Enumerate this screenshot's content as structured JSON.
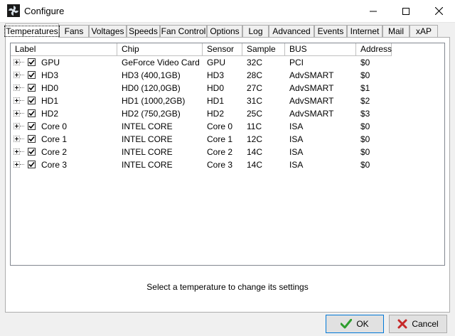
{
  "window": {
    "title": "Configure"
  },
  "tabs": [
    "Temperatures",
    "Fans",
    "Voltages",
    "Speeds",
    "Fan Control",
    "Options",
    "Log",
    "Advanced",
    "Events",
    "Internet",
    "Mail",
    "xAP"
  ],
  "columns": [
    "Label",
    "Chip",
    "Sensor",
    "Sample",
    "BUS",
    "Address"
  ],
  "rows": [
    {
      "label": "GPU",
      "chip": "GeForce Video Card",
      "sensor": "GPU",
      "sample": "32C",
      "bus": "PCI",
      "address": "$0"
    },
    {
      "label": "HD3",
      "chip": "HD3 (400,1GB)",
      "sensor": "HD3",
      "sample": "28C",
      "bus": "AdvSMART",
      "address": "$0"
    },
    {
      "label": "HD0",
      "chip": "HD0 (120,0GB)",
      "sensor": "HD0",
      "sample": "27C",
      "bus": "AdvSMART",
      "address": "$1"
    },
    {
      "label": "HD1",
      "chip": "HD1 (1000,2GB)",
      "sensor": "HD1",
      "sample": "31C",
      "bus": "AdvSMART",
      "address": "$2"
    },
    {
      "label": "HD2",
      "chip": "HD2 (750,2GB)",
      "sensor": "HD2",
      "sample": "25C",
      "bus": "AdvSMART",
      "address": "$3"
    },
    {
      "label": "Core 0",
      "chip": "INTEL CORE",
      "sensor": "Core 0",
      "sample": "11C",
      "bus": "ISA",
      "address": "$0"
    },
    {
      "label": "Core 1",
      "chip": "INTEL CORE",
      "sensor": "Core 1",
      "sample": "12C",
      "bus": "ISA",
      "address": "$0"
    },
    {
      "label": "Core 2",
      "chip": "INTEL CORE",
      "sensor": "Core 2",
      "sample": "14C",
      "bus": "ISA",
      "address": "$0"
    },
    {
      "label": "Core 3",
      "chip": "INTEL CORE",
      "sensor": "Core 3",
      "sample": "14C",
      "bus": "ISA",
      "address": "$0"
    }
  ],
  "status_text": "Select a temperature to change its settings",
  "buttons": {
    "ok": "OK",
    "cancel": "Cancel"
  },
  "colors": {
    "ok_check": "#2e9e2e",
    "cancel_x": "#c62828",
    "focus_border": "#0078d7"
  }
}
